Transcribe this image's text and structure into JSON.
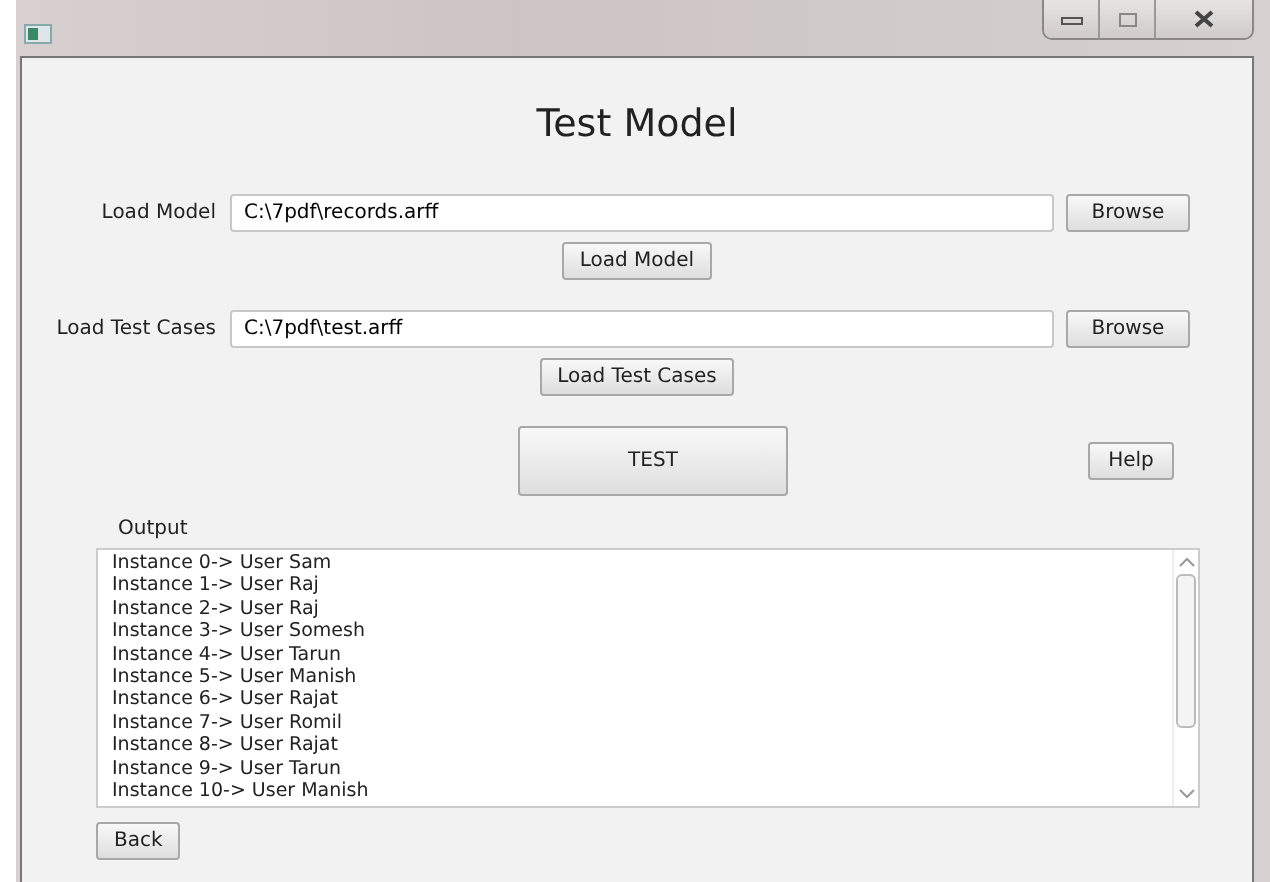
{
  "window": {
    "title": "Test Model"
  },
  "file_rows": [
    {
      "label": "Load Model",
      "value": "C:\\7pdf\\records.arff",
      "browse": "Browse",
      "action": "Load Model"
    },
    {
      "label": "Load Test Cases",
      "value": "C:\\7pdf\\test.arff",
      "browse": "Browse",
      "action": "Load Test Cases"
    }
  ],
  "test_button": "TEST",
  "help_button": "Help",
  "output": {
    "label": "Output",
    "lines": [
      "Instance 0-> User Sam",
      "Instance 1-> User Raj",
      "Instance 2-> User Raj",
      "Instance 3-> User Somesh",
      "Instance 4-> User Tarun",
      "Instance 5-> User Manish",
      "Instance 6-> User Rajat",
      "Instance 7-> User Romil",
      "Instance 8-> User Rajat",
      "Instance 9-> User Tarun",
      "Instance 10-> User Manish"
    ]
  },
  "back_button": "Back"
}
